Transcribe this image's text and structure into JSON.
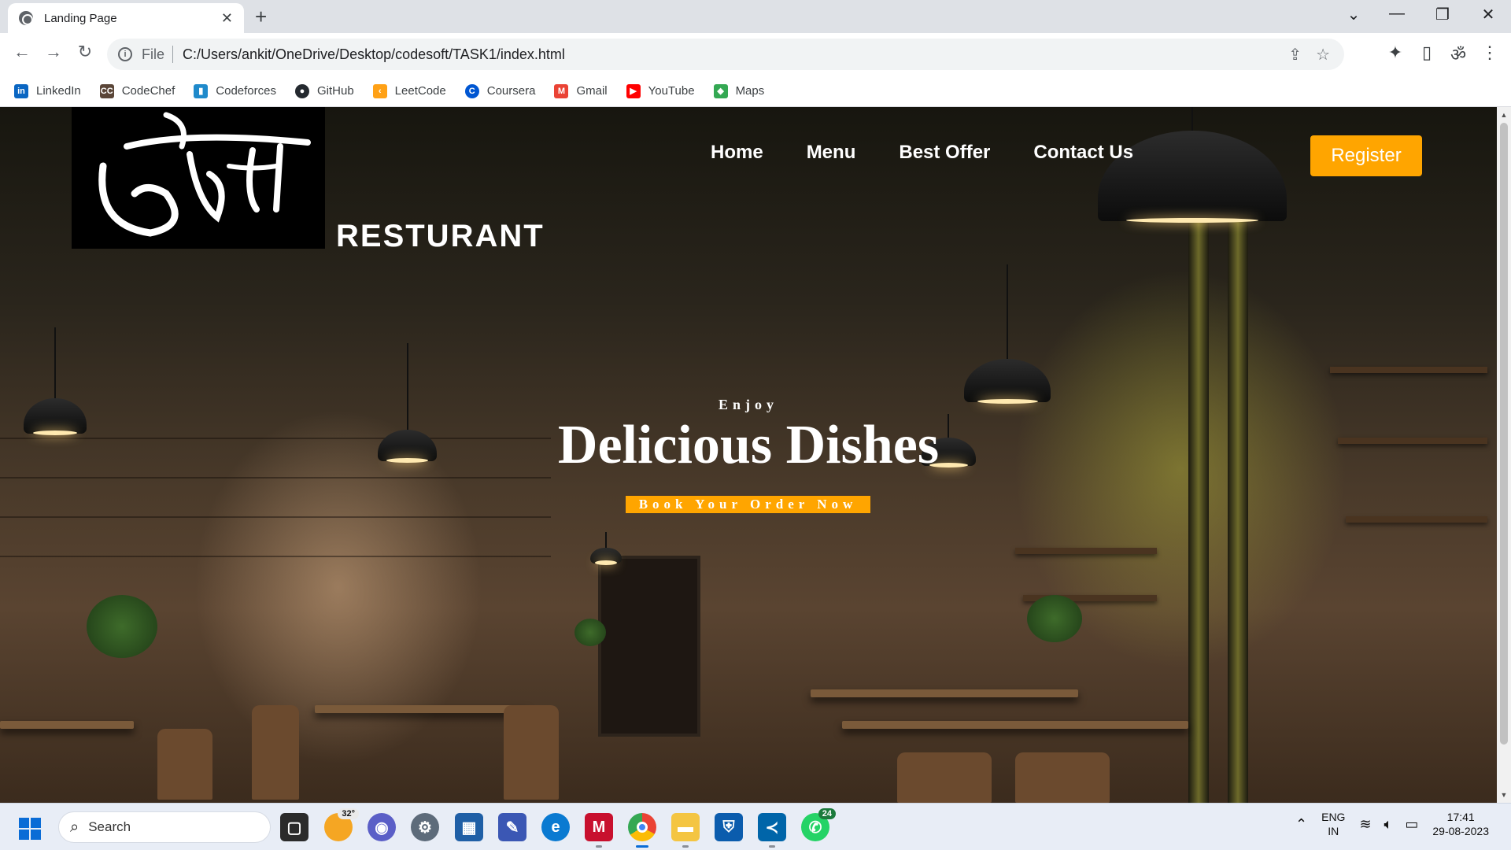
{
  "browser": {
    "tab_title": "Landing Page",
    "new_tab": "+",
    "url_scheme": "File",
    "url": "C:/Users/ankit/OneDrive/Desktop/codesoft/TASK1/index.html",
    "bookmarks": [
      {
        "label": "LinkedIn",
        "icon": "linkedin-icon",
        "color": "#0a66c2",
        "glyph": "in"
      },
      {
        "label": "CodeChef",
        "icon": "codechef-icon",
        "color": "#5b4638",
        "glyph": "CC"
      },
      {
        "label": "Codeforces",
        "icon": "codeforces-icon",
        "color": "#1f8acb",
        "glyph": "▮"
      },
      {
        "label": "GitHub",
        "icon": "github-icon",
        "color": "#24292f",
        "glyph": "●"
      },
      {
        "label": "LeetCode",
        "icon": "leetcode-icon",
        "color": "#ffa116",
        "glyph": "‹"
      },
      {
        "label": "Coursera",
        "icon": "coursera-icon",
        "color": "#0056d2",
        "glyph": "C"
      },
      {
        "label": "Gmail",
        "icon": "gmail-icon",
        "color": "#ea4335",
        "glyph": "M"
      },
      {
        "label": "YouTube",
        "icon": "youtube-icon",
        "color": "#ff0000",
        "glyph": "▶"
      },
      {
        "label": "Maps",
        "icon": "maps-icon",
        "color": "#34a853",
        "glyph": "◆"
      }
    ]
  },
  "page": {
    "logo_text": "सौकत",
    "brand": "RESTURANT",
    "nav": [
      "Home",
      "Menu",
      "Best Offer",
      "Contact Us"
    ],
    "register": "Register",
    "hero_kicker": "Enjoy",
    "hero_title": "Delicious Dishes",
    "cta": "Book Your Order Now",
    "accent": "#ffa500"
  },
  "taskbar": {
    "search_placeholder": "Search",
    "weather": "32°",
    "whatsapp_badge": "24",
    "lang_top": "ENG",
    "lang_bottom": "IN",
    "time": "17:41",
    "date": "29-08-2023"
  }
}
